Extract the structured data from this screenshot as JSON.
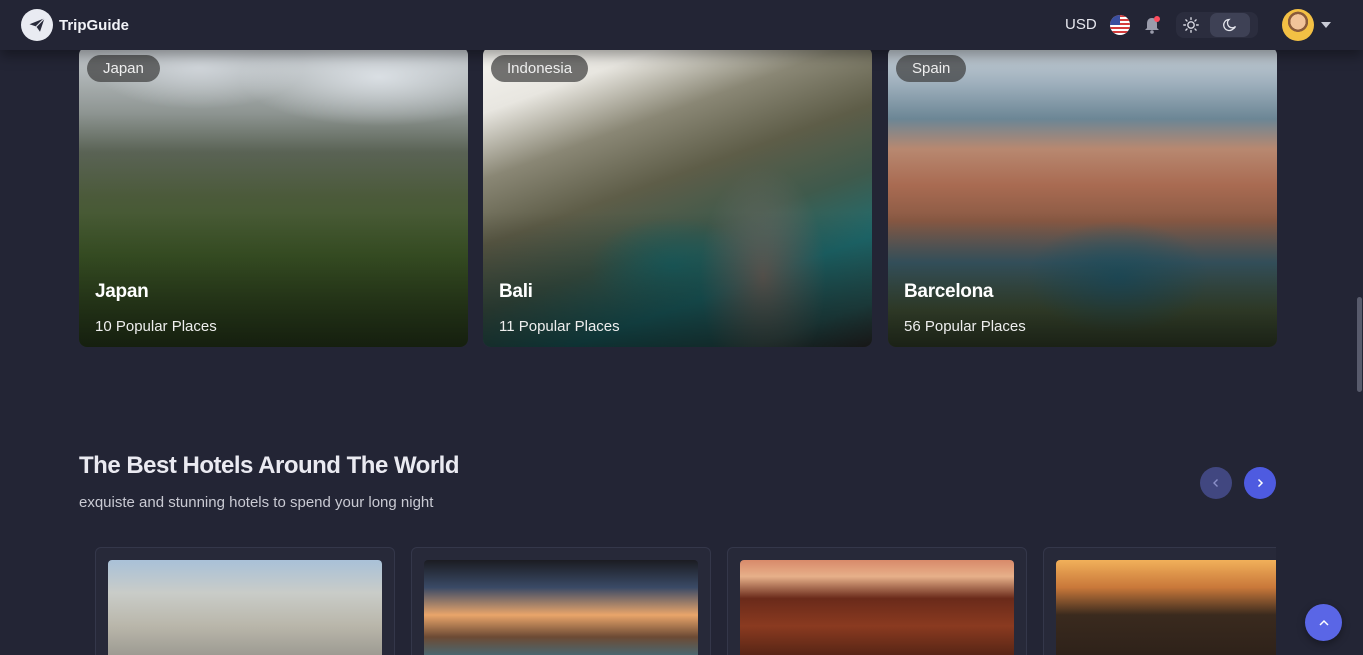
{
  "header": {
    "brand": "TripGuide",
    "currency": "USD"
  },
  "destinations": [
    {
      "country": "Japan",
      "name": "Japan",
      "places": "10 Popular Places"
    },
    {
      "country": "Indonesia",
      "name": "Bali",
      "places": "11 Popular Places"
    },
    {
      "country": "Spain",
      "name": "Barcelona",
      "places": "56 Popular Places"
    }
  ],
  "hotels_section": {
    "title": "The Best Hotels Around The World",
    "subtitle": "exquiste and stunning hotels to spend your long night"
  },
  "colors": {
    "background": "#232535",
    "accent": "#4e5be0"
  }
}
